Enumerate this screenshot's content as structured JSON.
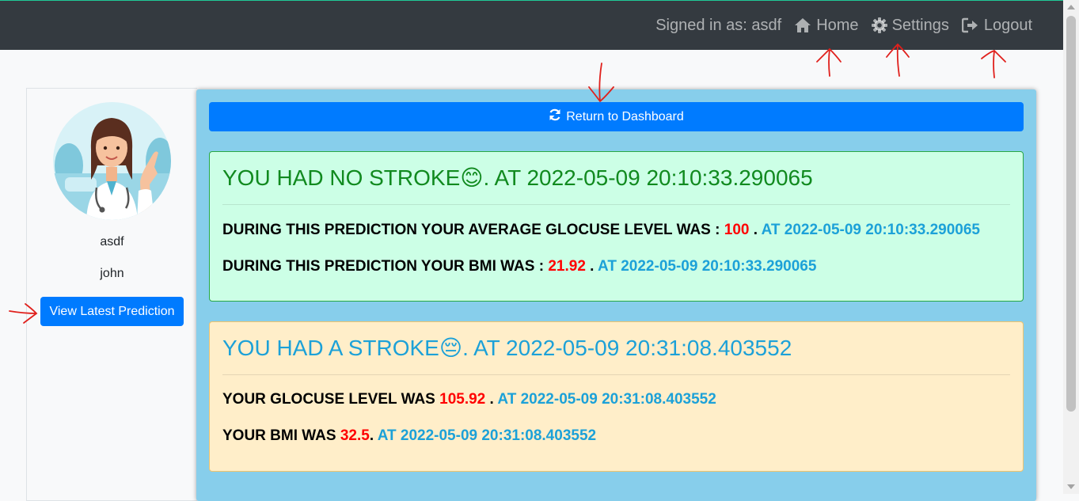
{
  "nav": {
    "signed_in": "Signed in as: asdf",
    "home": "Home",
    "settings": "Settings",
    "logout": "Logout"
  },
  "sidebar": {
    "username": "asdf",
    "name": "john",
    "latest_button": "View Latest Prediction"
  },
  "main": {
    "dashboard_button": "Return to Dashboard"
  },
  "no_stroke_card": {
    "title": "YOU HAD NO STROKE",
    "emoji": "😊",
    "title_suffix": ". AT 2022-05-09 20:10:33.290065",
    "line1_prefix": "DURING THIS PREDICTION YOUR AVERAGE GLOCUSE LEVEL WAS : ",
    "line1_value": "100",
    "line1_sep": " . ",
    "line1_ts": "AT 2022-05-09 20:10:33.290065",
    "line2_prefix": "DURING THIS PREDICTION YOUR BMI WAS : ",
    "line2_value": "21.92",
    "line2_sep": " . ",
    "line2_ts": "AT 2022-05-09 20:10:33.290065"
  },
  "stroke_card": {
    "title": "YOU HAD A STROKE",
    "emoji": "😔",
    "title_suffix": ". AT 2022-05-09 20:31:08.403552",
    "line1_prefix": "YOUR GLOCUSE LEVEL WAS ",
    "line1_value": "105.92",
    "line1_sep": " . ",
    "line1_ts": "AT 2022-05-09 20:31:08.403552",
    "line2_prefix": "YOUR BMI WAS ",
    "line2_value": "32.5",
    "line2_sep": ". ",
    "line2_ts": "AT 2022-05-09 20:31:08.403552"
  },
  "colors": {
    "navbar": "#343a40",
    "primary": "#007bff",
    "main_bg": "#87ceeb",
    "success_card": "#ccffe6",
    "warning_card": "#ffeec9",
    "value_red": "#ff0000",
    "timestamp_blue": "#1ca1d8",
    "annotation_red": "#e0201c"
  },
  "icons": [
    "home-icon",
    "gear-icon",
    "logout-icon",
    "refresh-icon",
    "doctor-avatar"
  ]
}
